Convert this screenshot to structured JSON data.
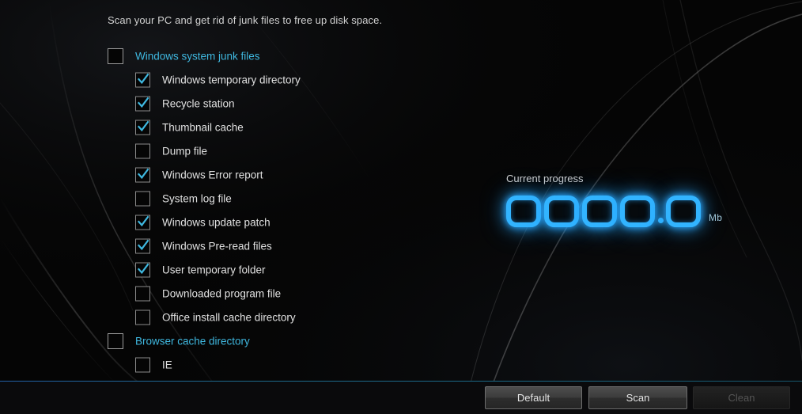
{
  "app": {
    "intro_text": "Scan your PC and get rid of junk files to free up disk space."
  },
  "colors": {
    "background": "#050505",
    "group_label": "#3fb8e0",
    "item_label": "#e0e0e0",
    "check_mark": "#3fb8e0",
    "led_digit": "#32b4ff",
    "divider": "#1b6a86"
  },
  "junk_list": {
    "groups": [
      {
        "label": "Windows system junk files",
        "checked": false,
        "items": [
          {
            "label": "Windows temporary directory",
            "checked": true
          },
          {
            "label": "Recycle station",
            "checked": true
          },
          {
            "label": "Thumbnail cache",
            "checked": true
          },
          {
            "label": "Dump file",
            "checked": false
          },
          {
            "label": "Windows Error report",
            "checked": true
          },
          {
            "label": "System log file",
            "checked": false
          },
          {
            "label": "Windows update patch",
            "checked": true
          },
          {
            "label": "Windows Pre-read files",
            "checked": true
          },
          {
            "label": "User temporary folder",
            "checked": true
          },
          {
            "label": "Downloaded program file",
            "checked": false
          },
          {
            "label": "Office install cache directory",
            "checked": false
          }
        ]
      },
      {
        "label": "Browser cache directory",
        "checked": false,
        "items": [
          {
            "label": "IE",
            "checked": false
          }
        ]
      }
    ]
  },
  "progress": {
    "title": "Current progress",
    "value": "0000.0",
    "digits": [
      "0",
      "0",
      "0",
      "0",
      "0"
    ],
    "decimal_after_index": 3,
    "unit": "Mb"
  },
  "footer": {
    "default_label": "Default",
    "scan_label": "Scan",
    "clean_label": "Clean",
    "clean_disabled": true
  }
}
